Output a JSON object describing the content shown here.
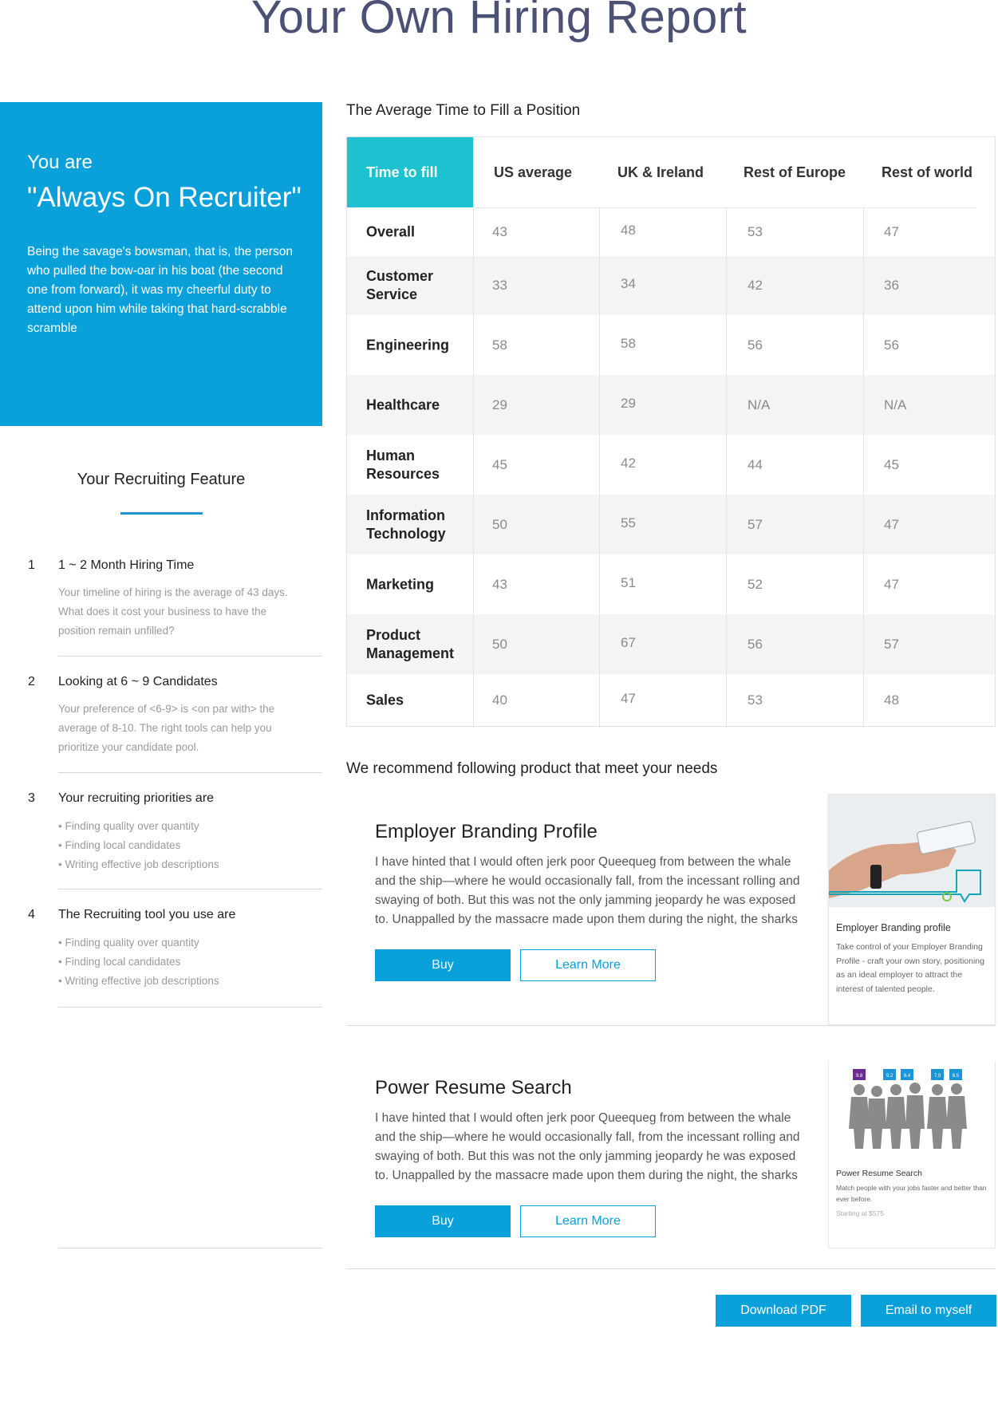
{
  "header": {
    "title": "Your Own Hiring Report"
  },
  "hero": {
    "you_are": "You are",
    "persona": "\"Always On Recruiter\"",
    "description": "Being the savage's bowsman, that is, the person who pulled the bow-oar in his boat (the second one from forward), it was my cheerful duty to attend upon him while taking that hard-scrabble scramble"
  },
  "features": {
    "title": "Your Recruiting Feature",
    "items": [
      {
        "num": "1",
        "title": "1 ~ 2 Month Hiring Time",
        "body": "Your timeline of hiring is the average of 43 days. What does it cost your business to have the position remain unfilled?"
      },
      {
        "num": "2",
        "title": "Looking at 6 ~ 9 Candidates",
        "body": "Your preference of <6-9> is <on par with> the average of 8-10.   The right tools can help you prioritize your candidate pool."
      },
      {
        "num": "3",
        "title": "Your recruiting priorities are",
        "bullets": [
          "• Finding quality over quantity",
          "• Finding local candidates",
          "• Writing effective job descriptions"
        ]
      },
      {
        "num": "4",
        "title": "The Recruiting tool you use are",
        "bullets": [
          "• Finding quality over quantity",
          "• Finding local candidates",
          "• Writing effective job descriptions"
        ]
      }
    ]
  },
  "time_table": {
    "title": "The Average Time to Fill a Position",
    "headers": [
      "Time to fill",
      "US average",
      "UK & Ireland",
      "Rest of Europe",
      "Rest of world"
    ],
    "rows": [
      {
        "label": "Overall",
        "values": [
          "43",
          "48",
          "53",
          "47"
        ]
      },
      {
        "label": "Customer Service",
        "values": [
          "33",
          "34",
          "42",
          "36"
        ]
      },
      {
        "label": "Engineering",
        "values": [
          "58",
          "58",
          "56",
          "56"
        ]
      },
      {
        "label": "Healthcare",
        "values": [
          "29",
          "29",
          "N/A",
          "N/A"
        ]
      },
      {
        "label": "Human Resources",
        "values": [
          "45",
          "42",
          "44",
          "45"
        ]
      },
      {
        "label": "Information Technology",
        "values": [
          "50",
          "55",
          "57",
          "47"
        ]
      },
      {
        "label": "Marketing",
        "values": [
          "43",
          "51",
          "52",
          "47"
        ]
      },
      {
        "label": "Product Management",
        "values": [
          "50",
          "67",
          "56",
          "57"
        ]
      },
      {
        "label": "Sales",
        "values": [
          "40",
          "47",
          "53",
          "48"
        ]
      }
    ]
  },
  "recommend": {
    "title": "We recommend following product that meet your needs",
    "products": [
      {
        "name": "Employer Branding Profile",
        "text": "I have hinted that I would often jerk poor Queequeg from between the whale and the ship—where he would occasionally fall, from the incessant rolling and swaying of both. But this was not the only jamming jeopardy he was exposed to. Unappalled by the massacre made upon them during the night, the sharks",
        "buy_label": "Buy",
        "learn_label": "Learn More",
        "card_title": "Employer Branding profile",
        "card_desc": "Take control of your Employer Branding Profile - craft your own story, positioning as an ideal employer to attract the interest of talented people."
      },
      {
        "name": "Power Resume Search",
        "text": "I have hinted that I would often jerk poor Queequeg from between the whale and the ship—where he would occasionally fall, from the incessant rolling and swaying of both. But this was not the only jamming jeopardy he was exposed to. Unappalled by the massacre made upon them during the night, the sharks",
        "buy_label": "Buy",
        "learn_label": "Learn More",
        "card_title": "Power Resume Search",
        "card_desc": "Match people with your jobs faster and better than ever before.",
        "card_price": "Starting at $575",
        "scores": [
          "9.8",
          "9.2",
          "8.4",
          "7.9",
          "6.5"
        ]
      }
    ]
  },
  "actions": {
    "download_label": "Download PDF",
    "email_label": "Email to myself"
  },
  "colors": {
    "primary": "#0aa0da",
    "table_header": "#1ec1cf",
    "title": "#4b5075"
  }
}
